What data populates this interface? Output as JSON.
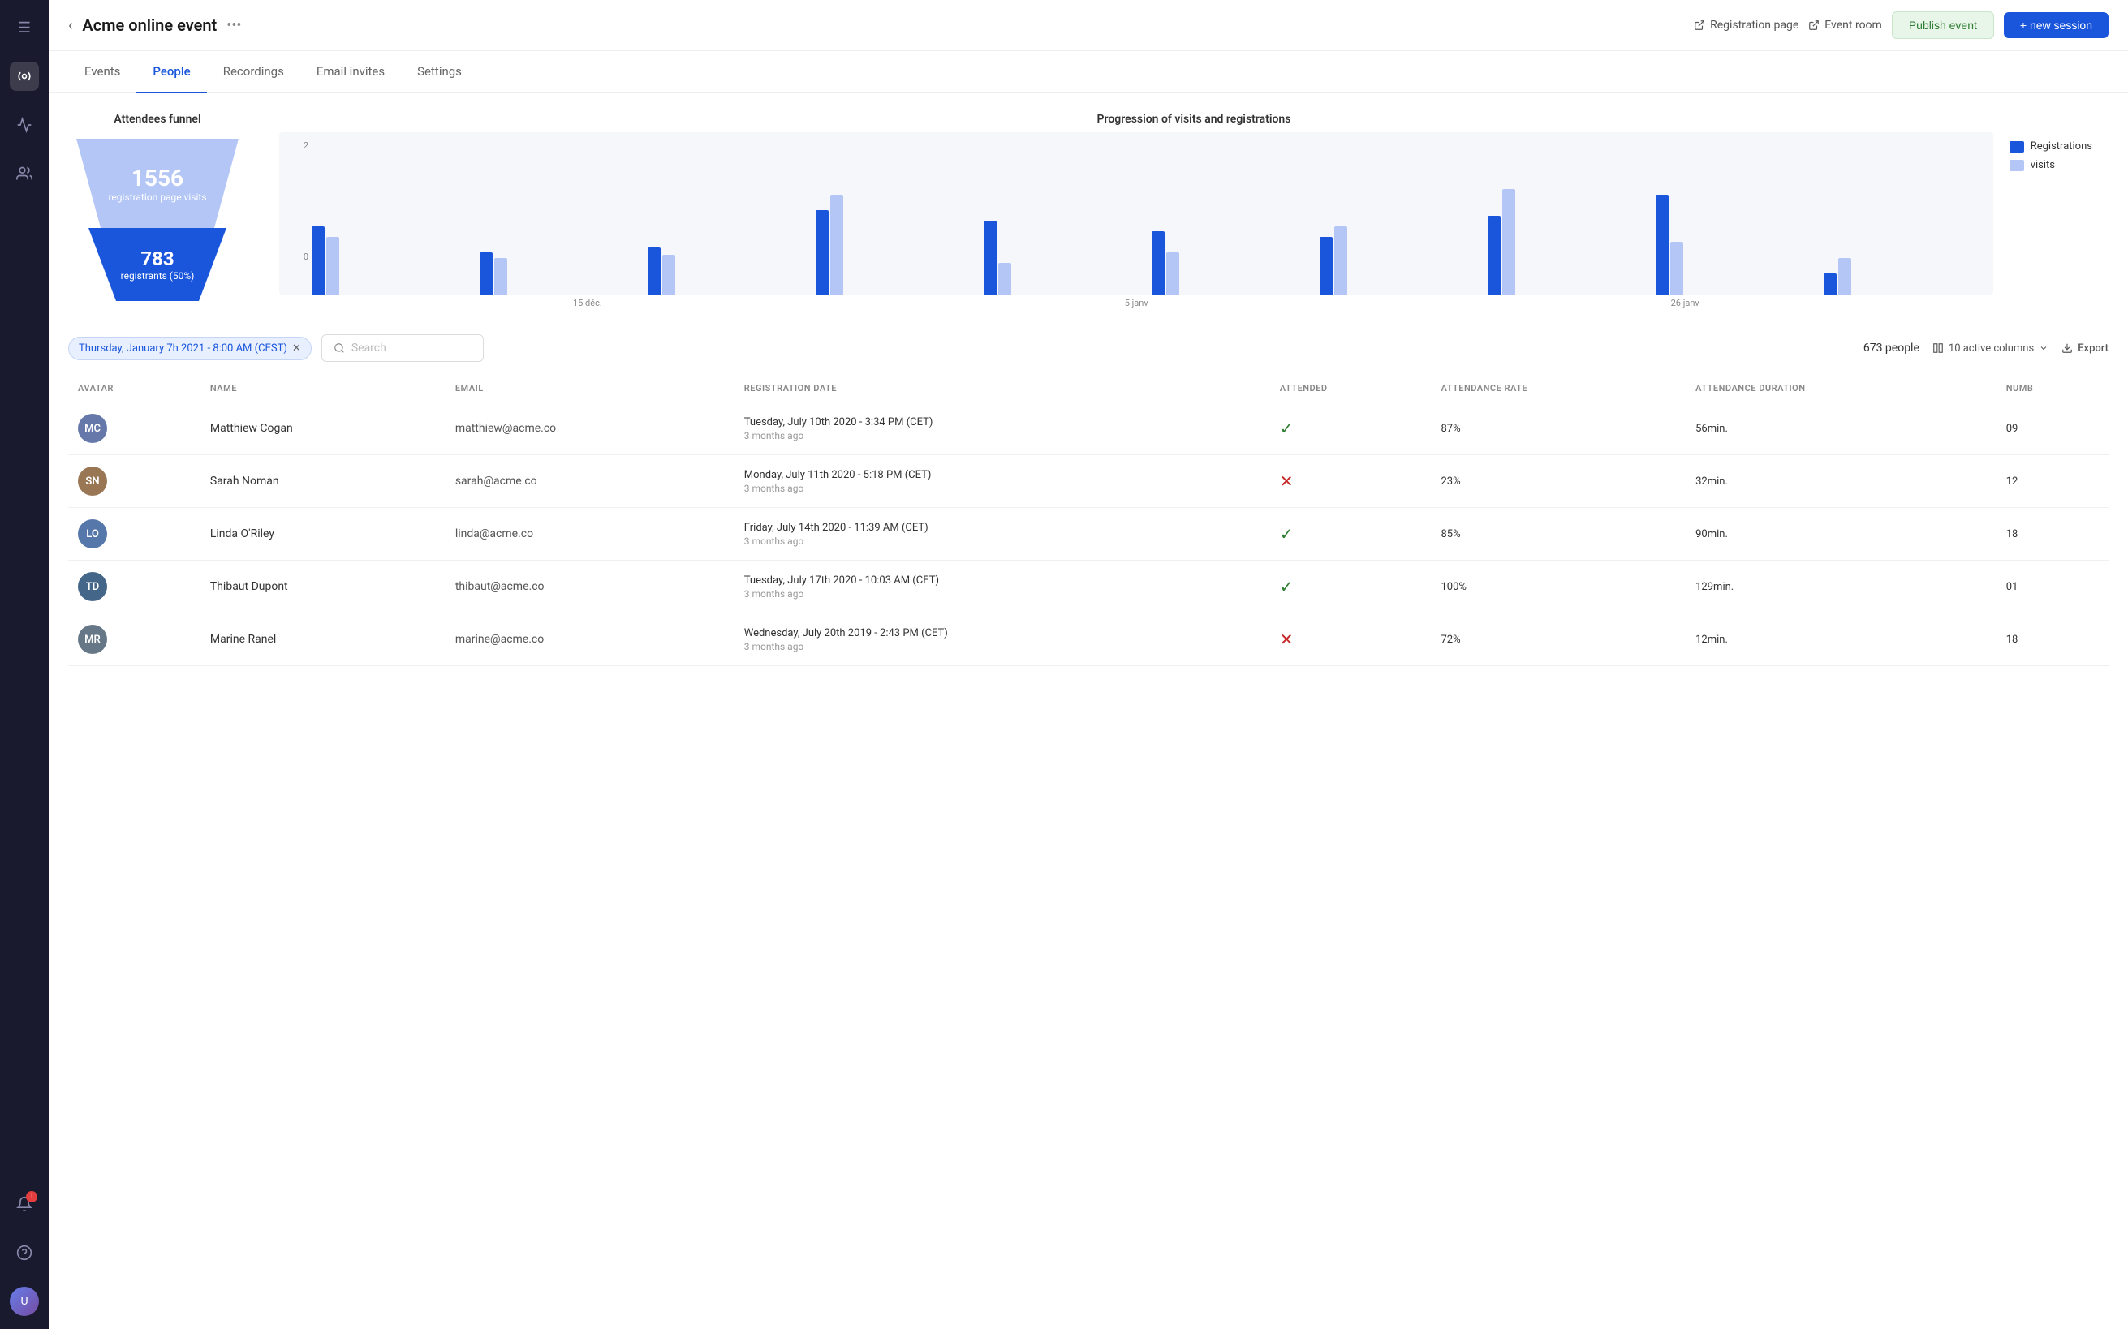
{
  "sidebar": {
    "icons": [
      {
        "name": "menu-icon",
        "symbol": "☰",
        "active": false
      },
      {
        "name": "broadcast-icon",
        "symbol": "📡",
        "active": true
      },
      {
        "name": "activity-icon",
        "symbol": "⚡",
        "active": false
      },
      {
        "name": "people-icon",
        "symbol": "👤",
        "active": false
      },
      {
        "name": "help-icon",
        "symbol": "?",
        "active": false
      },
      {
        "name": "notification-icon",
        "symbol": "🔔",
        "active": false,
        "badge": "1"
      }
    ]
  },
  "topbar": {
    "back_label": "‹",
    "title": "Acme online event",
    "more_label": "•••",
    "registration_page_label": "Registration page",
    "event_room_label": "Event room",
    "publish_label": "Publish event",
    "new_session_label": "+ new session"
  },
  "tabs": [
    {
      "id": "events",
      "label": "Events",
      "active": false
    },
    {
      "id": "people",
      "label": "People",
      "active": true
    },
    {
      "id": "recordings",
      "label": "Recordings",
      "active": false
    },
    {
      "id": "email-invites",
      "label": "Email invites",
      "active": false
    },
    {
      "id": "settings",
      "label": "Settings",
      "active": false
    }
  ],
  "funnel": {
    "title": "Attendees funnel",
    "visits_count": "1556",
    "visits_label": "registration page visits",
    "registrants_count": "783",
    "registrants_label": "registrants (50%)"
  },
  "chart": {
    "title": "Progression of visits and registrations",
    "legend": [
      {
        "label": "Registrations",
        "color": "#1a56db"
      },
      {
        "label": "visits",
        "color": "#b3c6f5"
      }
    ],
    "y_labels": [
      "2",
      "0"
    ],
    "x_labels": [
      "15 déc.",
      "5 janv",
      "26 janv"
    ],
    "bars": [
      {
        "registration": 65,
        "visit": 55
      },
      {
        "registration": 40,
        "visit": 35
      },
      {
        "registration": 45,
        "visit": 38
      },
      {
        "registration": 80,
        "visit": 95
      },
      {
        "registration": 70,
        "visit": 30
      },
      {
        "registration": 60,
        "visit": 40
      },
      {
        "registration": 55,
        "visit": 65
      },
      {
        "registration": 75,
        "visit": 100
      },
      {
        "registration": 95,
        "visit": 50
      },
      {
        "registration": 20,
        "visit": 35
      }
    ]
  },
  "table_toolbar": {
    "filter_label": "Thursday, January 7h 2021 - 8:00 AM (CEST)",
    "search_placeholder": "Search",
    "people_count": "673 people",
    "columns_label": "10 active columns",
    "export_label": "Export"
  },
  "table": {
    "headers": [
      "AVATAR",
      "NAME",
      "EMAIL",
      "REGISTRATION DATE",
      "ATTENDED",
      "ATTENDANCE RATE",
      "ATTENDANCE DURATION",
      "NUMB"
    ],
    "rows": [
      {
        "avatar_class": "c1",
        "avatar_initials": "MC",
        "name": "Matthiew Cogan",
        "email": "matthiew@acme.co",
        "reg_date": "Tuesday, July 10th 2020 - 3:34 PM (CET)",
        "reg_ago": "3 months ago",
        "attended": true,
        "attendance_rate": "87%",
        "duration": "56min.",
        "num": "09"
      },
      {
        "avatar_class": "c2",
        "avatar_initials": "SN",
        "name": "Sarah Noman",
        "email": "sarah@acme.co",
        "reg_date": "Monday, July 11th 2020 - 5:18 PM (CET)",
        "reg_ago": "3 months ago",
        "attended": false,
        "attendance_rate": "23%",
        "duration": "32min.",
        "num": "12"
      },
      {
        "avatar_class": "c3",
        "avatar_initials": "LO",
        "name": "Linda O'Riley",
        "email": "linda@acme.co",
        "reg_date": "Friday, July 14th 2020 - 11:39 AM (CET)",
        "reg_ago": "3 months ago",
        "attended": true,
        "attendance_rate": "85%",
        "duration": "90min.",
        "num": "18"
      },
      {
        "avatar_class": "c4",
        "avatar_initials": "TD",
        "name": "Thibaut Dupont",
        "email": "thibaut@acme.co",
        "reg_date": "Tuesday, July 17th 2020 - 10:03 AM (CET)",
        "reg_ago": "3 months ago",
        "attended": true,
        "attendance_rate": "100%",
        "duration": "129min.",
        "num": "01"
      },
      {
        "avatar_class": "c5",
        "avatar_initials": "MR",
        "name": "Marine Ranel",
        "email": "marine@acme.co",
        "reg_date": "Wednesday, July 20th 2019 - 2:43 PM (CET)",
        "reg_ago": "3 months ago",
        "attended": false,
        "attendance_rate": "72%",
        "duration": "12min.",
        "num": "18"
      }
    ]
  }
}
